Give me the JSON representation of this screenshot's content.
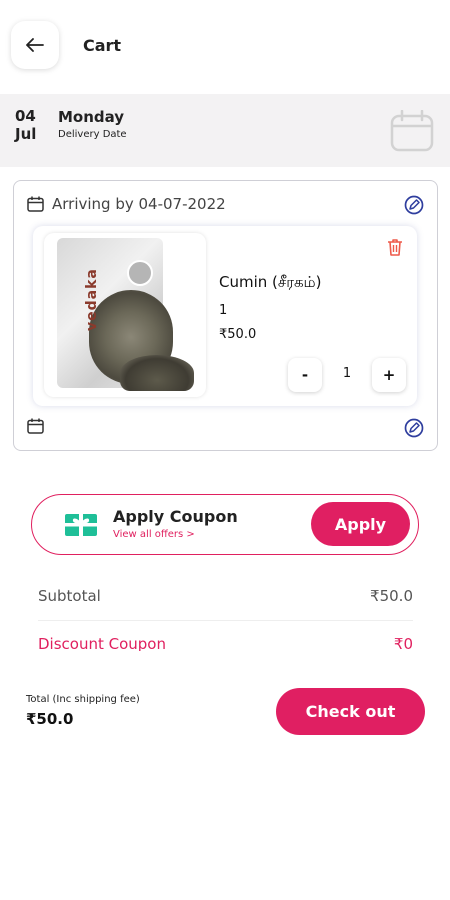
{
  "header": {
    "title": "Cart",
    "back_icon": "arrow-left-icon"
  },
  "delivery": {
    "day": "04",
    "month": "Jul",
    "weekday": "Monday",
    "label": "Delivery Date",
    "calendar_icon": "calendar-icon"
  },
  "shipment": {
    "arriving_text": "Arriving by 04-07-2022",
    "edit_icon": "edit-icon",
    "item": {
      "image_brand": "vedaka",
      "name": "Cumin (சீரகம்)",
      "quantity": "1",
      "price": "₹50.0",
      "stepper": {
        "minus": "-",
        "value": "1",
        "plus": "+"
      },
      "delete_icon": "trash-icon"
    }
  },
  "coupon": {
    "icon": "gift-card-icon",
    "title": "Apply Coupon",
    "link": "View all offers >",
    "button": "Apply"
  },
  "summary": {
    "subtotal_label": "Subtotal",
    "subtotal_value": "₹50.0",
    "discount_label": "Discount Coupon",
    "discount_value": "₹0"
  },
  "footer": {
    "total_label": "Total (Inc shipping fee)",
    "total_value": "₹50.0",
    "checkout": "Check out"
  },
  "colors": {
    "accent": "#e01f62",
    "date_bar": "#f3f2f3",
    "edit_icon": "#2f3e9e",
    "coupon_icon": "#1fbf98",
    "delete_icon": "#ee5a4a"
  }
}
